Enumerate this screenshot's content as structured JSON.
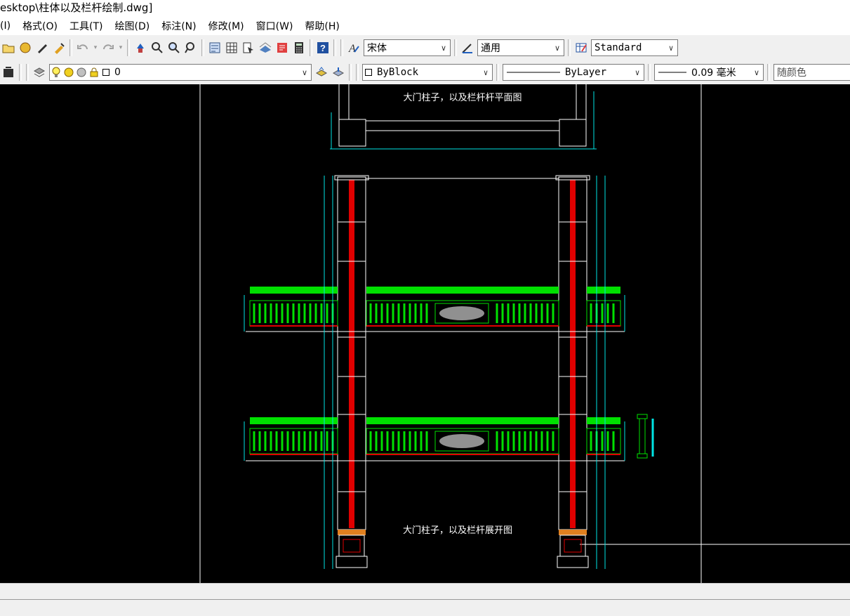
{
  "window": {
    "title": "esktop\\柱体以及栏杆绘制.dwg]"
  },
  "menu": {
    "items": [
      "(I)",
      "格式(O)",
      "工具(T)",
      "绘图(D)",
      "标注(N)",
      "修改(M)",
      "窗口(W)",
      "帮助(H)"
    ]
  },
  "toolbar": {
    "text_style": "宋体",
    "dim_style": "通用",
    "table_style": "Standard",
    "layer": "0",
    "color": "ByBlock",
    "linetype": "ByLayer",
    "lineweight": "0.09 毫米",
    "plot_style": "随颜色"
  },
  "drawing": {
    "title_top": "大门柱子，以及栏杆杆平面图",
    "title_bottom": "大门柱子，以及栏杆展开图"
  },
  "colors": {
    "canvas": "#000000",
    "pillar_fill": "#e00000",
    "railing": "#00e000",
    "dimension": "#00e5e5",
    "line": "#ffffff"
  }
}
